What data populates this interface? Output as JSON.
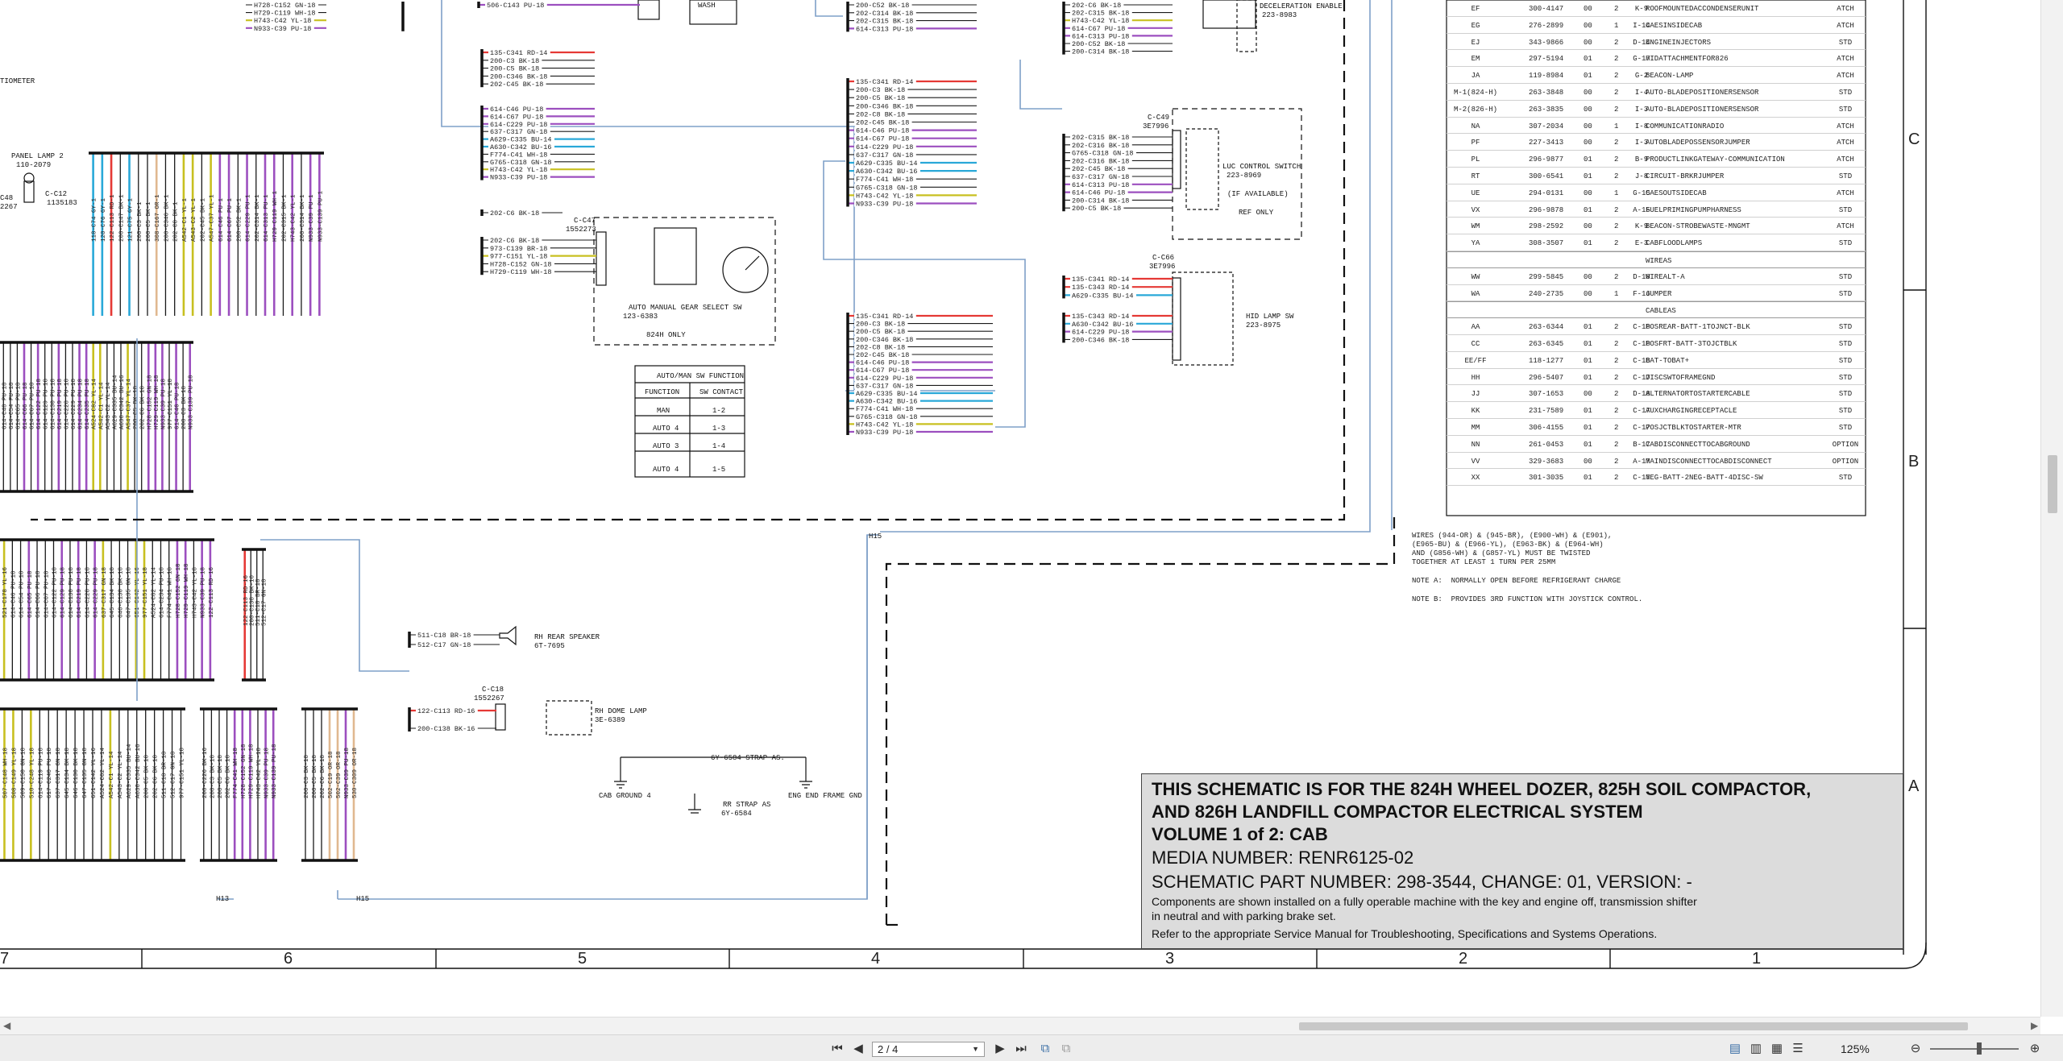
{
  "viewer": {
    "page_indicator": "2 / 4",
    "zoom": "125%"
  },
  "grid": {
    "columns": [
      "6",
      "5",
      "4",
      "3",
      "2",
      "1"
    ],
    "rows": [
      "C",
      "B",
      "A"
    ]
  },
  "labels": {
    "tiometer": "TIOMETER",
    "panel_lamp": "PANEL LAMP 2",
    "panel_lamp_part": "110-2079",
    "c12": "C-C12",
    "c12_part": "1135183",
    "c48": "C48",
    "c48_part": "2267",
    "c47": "C-C47",
    "c47_part": "1552273",
    "gear_select": "AUTO MANUAL GEAR SELECT SW",
    "gear_select_part": "123-6383",
    "only_824h": "824H ONLY",
    "c49": "C-C49",
    "c49_part": "3E7996",
    "luc": "LUC CONTROL SWITCH",
    "luc_part": "223-8969",
    "if_available": "(IF AVAILABLE)",
    "ref_only": "REF ONLY",
    "c66": "C-C66",
    "c66_part": "3E7996",
    "hid": "HID LAMP SW",
    "hid_part": "223-8975",
    "decel": "DECELERATION ENABLE",
    "decel_part": "223-8983",
    "wash": "WASH",
    "rh_speaker": "RH REAR SPEAKER",
    "rh_speaker_part": "6T-7695",
    "c18": "C-C18",
    "c18_part": "1552267",
    "rh_dome": "RH DOME LAMP",
    "rh_dome_part": "3E-6389",
    "strap": "6Y-6584 STRAP AS.",
    "cab_ground": "CAB GROUND 4",
    "eng_end": "ENG END FRAME GND",
    "rr_strap": "RR STRAP AS",
    "rr_strap_part": "6Y-6584",
    "h15a": "H15",
    "h15b": "H15",
    "h13": "H13"
  },
  "automan_table": {
    "title": "AUTO/MAN SW FUNCTION",
    "headers": [
      "FUNCTION",
      "SW CONTACT"
    ],
    "rows": [
      [
        "MAN",
        "1-2"
      ],
      [
        "AUTO 4",
        "1-3"
      ],
      [
        "AUTO 3",
        "1-4"
      ],
      [
        "AUTO 4",
        "1-5"
      ]
    ]
  },
  "wire_groups": {
    "top_left": [
      "H728-C152 GN-18",
      "H729-C119 WH-18",
      "H743-C42 YL-18",
      "N933-C39 PU-18"
    ],
    "g1": [
      "135-C341 RD-14",
      "200-C3 BK-18",
      "200-C5 BK-18",
      "200-C346 BK-18",
      "202-C45 BK-18"
    ],
    "g2": [
      "614-C46 PU-18",
      "614-C67 PU-18",
      "614-C229 PU-18",
      "637-C317 GN-18",
      "A629-C335 BU-14",
      "A630-C342 BU-16",
      "F774-C41 WH-18",
      "G765-C318 GN-18",
      "H743-C42 YL-18",
      "N933-C39 PU-18"
    ],
    "g3": [
      "202-C6 BK-18",
      "973-C139 BR-18",
      "977-C151 YL-18",
      "H728-C152 GN-18",
      "H729-C119 WH-18"
    ],
    "g3b": [
      "202-C6 BK-18"
    ],
    "g4": [
      "135-C341 RD-14",
      "200-C3 BK-18",
      "200-C5 BK-18",
      "200-C346 BK-18",
      "202-C8 BK-18",
      "202-C45 BK-18",
      "614-C46 PU-18",
      "614-C67 PU-18",
      "614-C229 PU-18",
      "637-C317 GN-18",
      "A629-C335 BU-14",
      "A630-C342 BU-16",
      "F774-C41 WH-18",
      "G765-C318 GN-18",
      "H743-C42 YL-18",
      "N933-C39 PU-18"
    ],
    "g5": [
      "135-C341 RD-14",
      "200-C3 BK-18",
      "200-C5 BK-18",
      "200-C346 BK-18",
      "202-C8 BK-18",
      "202-C45 BK-18",
      "614-C46 PU-18",
      "614-C67 PU-18",
      "614-C229 PU-18",
      "637-C317 GN-18",
      "A629-C335 BU-14",
      "A630-C342 BU-16",
      "F774-C41 WH-18",
      "G765-C318 GN-18",
      "H743-C42 YL-18",
      "N933-C39 PU-18"
    ],
    "g6": [
      "200-C52 BK-18",
      "202-C314 BK-18",
      "202-C315 BK-18",
      "614-C313 PU-18"
    ],
    "g7": [
      "202-C6 BK-18",
      "202-C315 BK-18",
      "H743-C42 YL-18",
      "614-C67 PU-18",
      "614-C313 PU-18",
      "200-C52 BK-18",
      "200-C314 BK-18"
    ],
    "g8": [
      "202-C315 BK-18",
      "202-C316 BK-18",
      "G765-C318 GN-18",
      "202-C316 BK-18",
      "202-C45 BK-18",
      "637-C317 GN-18",
      "614-C313 PU-18",
      "614-C46 PU-18",
      "200-C314 BK-18",
      "200-C5 BK-18"
    ],
    "g9": [
      "135-C341 RD-14",
      "135-C343 RD-14",
      "A629-C335 BU-14"
    ],
    "g10": [
      "135-C343 RD-14",
      "A630-C342 BU-16",
      "614-C229 PU-18",
      "200-C346 BK-18"
    ],
    "g11": [
      "511-C18 BR-18",
      "512-C17 GN-18"
    ],
    "g12": [
      "122-C113 RD-16",
      "200-C138 BK-16"
    ],
    "wash": [
      "506-C143 PU-18"
    ]
  },
  "parts_list": {
    "rows1": [
      [
        "EF",
        "300-4147",
        "00",
        "2",
        "K-9",
        "ROOFMOUNTEDACCONDENSERUNIT",
        "ATCH"
      ],
      [
        "EG",
        "276-2899",
        "00",
        "1",
        "I-14",
        "CAESINSIDECAB",
        "ATCH"
      ],
      [
        "EJ",
        "343-9866",
        "00",
        "2",
        "D-14",
        "ENGINEINJECTORS",
        "STD"
      ],
      [
        "EM",
        "297-5194",
        "01",
        "2",
        "G-17",
        "HIDATTACHMENTFOR826",
        "ATCH"
      ],
      [
        "JA",
        "119-8984",
        "01",
        "2",
        "G-2",
        "BEACON-LAMP",
        "ATCH"
      ],
      [
        "M-1(824-H)",
        "263-3848",
        "00",
        "2",
        "I-4",
        "AUTO-BLADEPOSITIONERSENSOR",
        "STD"
      ],
      [
        "M-2(826-H)",
        "263-3835",
        "00",
        "2",
        "I-3",
        "AUTO-BLADEPOSITIONERSENSOR",
        "STD"
      ],
      [
        "NA",
        "307-2034",
        "00",
        "1",
        "I-8",
        "COMMUNICATIONRADIO",
        "ATCH"
      ],
      [
        "PF",
        "227-3413",
        "00",
        "2",
        "I-3",
        "AUTOBLADEPOSSENSORJUMPER",
        "ATCH"
      ],
      [
        "PL",
        "296-9877",
        "01",
        "2",
        "B-9",
        "PRODUCTLINKGATEWAY-COMMUNICATION",
        "ATCH"
      ],
      [
        "RT",
        "300-6541",
        "01",
        "2",
        "J-8",
        "CIRCUIT-BRKRJUMPER",
        "STD"
      ],
      [
        "UE",
        "294-0131",
        "00",
        "1",
        "G-15",
        "CAESOUTSIDECAB",
        "ATCH"
      ],
      [
        "VX",
        "296-9878",
        "01",
        "2",
        "A-15",
        "FUELPRIMINGPUMPHARNESS",
        "STD"
      ],
      [
        "WM",
        "298-2592",
        "00",
        "2",
        "K-9",
        "BEACON-STROBEWASTE-MNGMT",
        "ATCH"
      ],
      [
        "YA",
        "308-3507",
        "01",
        "2",
        "E-3",
        "CABFLOODLAMPS",
        "STD"
      ]
    ],
    "sec_wireas": "WIREAS",
    "rows2": [
      [
        "WW",
        "299-5845",
        "00",
        "2",
        "D-18",
        "WIREALT-A",
        "STD"
      ],
      [
        "WA",
        "240-2735",
        "00",
        "1",
        "F-16",
        "JUMPER",
        "STD"
      ]
    ],
    "sec_cableas": "CABLEAS",
    "rows3": [
      [
        "AA",
        "263-6344",
        "01",
        "2",
        "C-18",
        "POSREAR-BATT-1TOJNCT-BLK",
        "STD"
      ],
      [
        "CC",
        "263-6345",
        "01",
        "2",
        "C-18",
        "POSFRT-BATT-3TOJCTBLK",
        "STD"
      ],
      [
        "EE/FF",
        "118-1277",
        "01",
        "2",
        "C-18",
        "BAT-TOBAT+",
        "STD"
      ],
      [
        "HH",
        "296-5407",
        "01",
        "2",
        "C-17",
        "DISCSWTOFRAMEGND",
        "STD"
      ],
      [
        "JJ",
        "307-1653",
        "00",
        "2",
        "D-18",
        "ALTERNATORTOSTARTERCABLE",
        "STD"
      ],
      [
        "KK",
        "231-7589",
        "01",
        "2",
        "C-17",
        "AUXCHARGINGRECEPTACLE",
        "STD"
      ],
      [
        "MM",
        "306-4155",
        "01",
        "2",
        "C-17",
        "POSJCTBLKTOSTARTER-MTR",
        "STD"
      ],
      [
        "NN",
        "261-0453",
        "01",
        "2",
        "B-17",
        "CABDISCONNECTTOCABGROUND",
        "OPTION"
      ],
      [
        "VV",
        "329-3683",
        "00",
        "2",
        "A-17",
        "MAINDISCONNECTTOCABDISCONNECT",
        "OPTION"
      ],
      [
        "XX",
        "301-3035",
        "01",
        "2",
        "C-17",
        "NEG-BATT-2NEG-BATT-4DISC-SW",
        "STD"
      ]
    ]
  },
  "notes": [
    "WIRES (944-OR) & (945-BR), (E900-WH) & (E901),",
    "(E965-BU) & (E966-YL), (E963-BK) & (E964-WH)",
    "AND (G856-WH) & (G857-YL) MUST BE TWISTED",
    "TOGETHER AT LEAST 1 TURN PER 25MM"
  ],
  "note_a": "NOTE A:  NORMALLY OPEN BEFORE REFRIGERANT CHARGE",
  "note_b": "NOTE B:  PROVIDES 3RD FUNCTION WITH JOYSTICK CONTROL.",
  "title_block": {
    "line1": "THIS SCHEMATIC IS FOR THE 824H WHEEL DOZER, 825H SOIL COMPACTOR,",
    "line2": "AND 826H LANDFILL COMPACTOR ELECTRICAL SYSTEM",
    "line3": "VOLUME 1 of 2: CAB",
    "media": "MEDIA NUMBER: RENR6125-02",
    "part": "SCHEMATIC PART NUMBER: 298-3544, CHANGE: 01, VERSION: -",
    "desc1": "Components are shown installed on a fully operable machine with the key and engine off, transmission shifter",
    "desc2": "in neutral and with parking brake set.",
    "desc3": "Refer to the appropriate Service Manual for Troubleshooting, Specifications and Systems Operations."
  },
  "colors": {
    "wire_red": "#e53935",
    "wire_blue": "#29a8d8",
    "wire_purple": "#9c4fbf",
    "wire_yellow": "#c8c020",
    "wire_tan": "#e0b890",
    "wire_black": "#1a1a1a",
    "harness_line": "#7fa0c8"
  },
  "vertical_bundles": {
    "b1": {
      "colors": [
        "#29a8d8",
        "#29a8d8",
        "#e53935",
        "#1a1a1a",
        "#29a8d8",
        "#1a1a1a",
        "#1a1a1a",
        "#e0b890",
        "#1a1a1a",
        "#1a1a1a",
        "#c8c020",
        "#c8c020",
        "#1a1a1a",
        "#c8c020",
        "#9c4fbf",
        "#9c4fbf",
        "#1a1a1a",
        "#9c4fbf",
        "#1a1a1a",
        "#9c4fbf",
        "#9c4fbf",
        "#1a1a1a",
        "#9c4fbf",
        "#1a1a1a",
        "#9c4fbf",
        "#9c4fbf"
      ],
      "labels": [
        "118-C74 GY-1",
        "120-C76 GY-1",
        "122-C113 RD-1",
        "200-C147 BK-1",
        "121-C75 GY-1",
        "200-C3 BK-1",
        "200-C5 BK-1",
        "308-C167 OR-1",
        "200-C346 BK-1",
        "202-C8 BK-1",
        "A542-C1 YL-1",
        "A543-C2 YL-1",
        "202-C45 BK-1",
        "A547-C37 YL-1",
        "614-C46 PU-1",
        "614-C67 PU-1",
        "200-C52 BK-1",
        "614-C229 PU-1",
        "202-C314 BK-1",
        "614-C313 PU-1",
        "H729-C119 WH-1",
        "202-C315 BK-1",
        "H743-C42 YL-1",
        "200-C314 BK-1",
        "N933-C39 PU-1",
        "N933-C139 PU-1"
      ]
    },
    "b2": {
      "colors": [
        "#1a1a1a",
        "#1a1a1a",
        "#1a1a1a",
        "#9c4fbf",
        "#1a1a1a",
        "#9c4fbf",
        "#1a1a1a",
        "#1a1a1a",
        "#9c4fbf",
        "#1a1a1a",
        "#1a1a1a",
        "#9c4fbf",
        "#9c4fbf",
        "#c8c020",
        "#c8c020",
        "#1a1a1a",
        "#1a1a1a",
        "#1a1a1a",
        "#c8c020",
        "#1a1a1a",
        "#1a1a1a",
        "#9c4fbf",
        "#9c4fbf",
        "#9c4fbf",
        "#1a1a1a",
        "#9c4fbf",
        "#1a1a1a",
        "#9c4fbf"
      ],
      "labels": [
        "614-C48 PU-18",
        "614-C54 PU-18",
        "614-C65 PU-18",
        "614-C66 PU-18",
        "614-C67 PU-18",
        "614-C122 PU-18",
        "614-C129 PU-18",
        "614-C130 PU-18",
        "614-C219 PU-18",
        "614-C228 PU-18",
        "614-C229 PU-18",
        "614-C234 PU-18",
        "614-C235 PU-18",
        "A524-C82 YL-14",
        "A542-C1 YL-14",
        "A543-C2 YL-14",
        "A629-C335 BU-14",
        "A630-C342 BU-16",
        "A547-C37 YL-14",
        "200-C5 BK-18",
        "202-C6 BK-18",
        "H728-C152 GN-18",
        "H729-C119 WH-18",
        "N933-C39 PU-18",
        "977-C151 YL-18",
        "614-C46 PU-18",
        "200-C3 BK-18",
        "N933-C139 PU-18"
      ]
    },
    "b3": {
      "colors": [
        "#c8c020",
        "#1a1a1a",
        "#1a1a1a",
        "#9c4fbf",
        "#1a1a1a",
        "#1a1a1a",
        "#1a1a1a",
        "#9c4fbf",
        "#1a1a1a",
        "#9c4fbf",
        "#1a1a1a",
        "#9c4fbf",
        "#c8c020",
        "#1a1a1a",
        "#1a1a1a",
        "#1a1a1a",
        "#c8c020",
        "#c8c020",
        "#1a1a1a",
        "#1a1a1a",
        "#1a1a1a",
        "#9c4fbf",
        "#9c4fbf",
        "#1a1a1a",
        "#9c4fbf",
        "#9c4fbf"
      ],
      "labels": [
        "521-C178 YL-16",
        "614-C46 PU-18",
        "614-C54 PU-18",
        "614-C65 PU-18",
        "614-C66 PU-18",
        "614-C67 PU-18",
        "614-C122 PU-18",
        "614-C129 PU-18",
        "614-C130 PU-18",
        "614-C219 PU-18",
        "614-C228 PU-18",
        "614-C229 PU-18",
        "637-C317 GN-18",
        "645-C134 BK-18",
        "646-C130 BK-18",
        "647-C135 GN-18",
        "651-C142 YL-16",
        "977-C151 YL-18",
        "A524-C82 YL-14",
        "614-C234 PU-18",
        "F774-C41 WH-18",
        "H728-C152 GN-18",
        "H729-C119 WH-18",
        "H743-C42 YL-18",
        "N933-C39 PU-18",
        "122-C113 RD-16"
      ]
    },
    "b3b": {
      "colors": [
        "#e53935",
        "#1a1a1a",
        "#1a1a1a",
        "#1a1a1a"
      ],
      "labels": [
        "122-C113 RD-16",
        "200-C138 BK-16",
        "511-C18 BR-18",
        "512-C17 GN-18"
      ]
    },
    "b4": {
      "colors": [
        "#c8c020",
        "#c8c020",
        "#1a1a1a",
        "#c8c020",
        "#1a1a1a",
        "#1a1a1a",
        "#1a1a1a",
        "#1a1a1a",
        "#1a1a1a",
        "#1a1a1a",
        "#1a1a1a",
        "#1a1a1a",
        "#c8c020",
        "#1a1a1a",
        "#1a1a1a",
        "#1a1a1a",
        "#1a1a1a",
        "#1a1a1a",
        "#1a1a1a",
        "#1a1a1a",
        "#1a1a1a"
      ],
      "labels": [
        "507-C148 WH-18",
        "508-C149 YL-18",
        "509-C150 GN-18",
        "510-C248 YL-18",
        "614-C119 PU-18",
        "617-C240 PU-18",
        "637-C317 GN-18",
        "645-C134 BK-18",
        "646-C130 BK-18",
        "647-C135 GN-18",
        "651-C142 YL-16",
        "A524-C82 YL-14",
        "A542-C1 YL-14",
        "A543-C2 YL-14",
        "A629-C335 BU-14",
        "A630-C342 BU-16",
        "200-C5 BK-18",
        "202-C6 BK-18",
        "511-C18 BR-18",
        "512-C17 GN-18",
        "977-C151 YL-18"
      ]
    },
    "b5": {
      "colors": [
        "#1a1a1a",
        "#1a1a1a",
        "#1a1a1a",
        "#1a1a1a",
        "#9c4fbf",
        "#9c4fbf",
        "#9c4fbf",
        "#1a1a1a",
        "#9c4fbf",
        "#9c4fbf"
      ],
      "labels": [
        "200-C226 BK-16",
        "200-C3 BK-18",
        "200-C5 BK-18",
        "202-C6 BK-18",
        "F774-C41 WH-18",
        "H728-C152 GN-18",
        "H729-C119 WH-18",
        "H743-C42 YL-18",
        "N933-C39 PU-18",
        "N933-C139 PU-18"
      ]
    },
    "b6": {
      "colors": [
        "#1a1a1a",
        "#1a1a1a",
        "#1a1a1a",
        "#e0b890",
        "#e0b890",
        "#9c4fbf",
        "#e0b890"
      ],
      "labels": [
        "200-C3 BK-18",
        "200-C5 BK-18",
        "202-C6 BK-18",
        "502-C19 OR-18",
        "502-C39 OR-18",
        "N933-C39 PU-18",
        "530-C309 OR-18"
      ]
    }
  }
}
